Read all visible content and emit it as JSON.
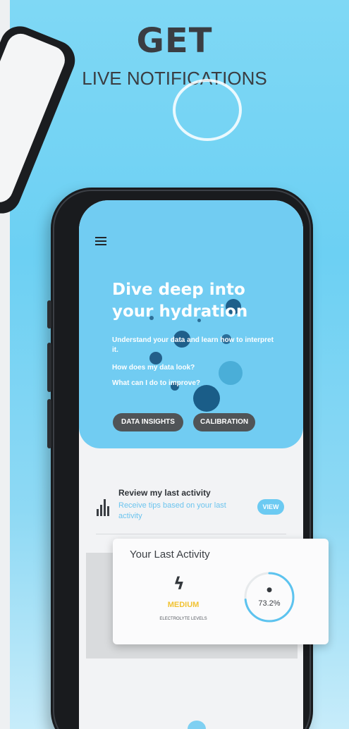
{
  "header": {
    "title": "GET",
    "subtitle": "LIVE NOTIFICATIONS"
  },
  "hero": {
    "title": "Dive deep into your hydration",
    "text1": "Understand your data and learn how to interpret it.",
    "text2": "How does my data look?",
    "text3": "What can I do to improve?",
    "buttons": {
      "insights": "DATA INSIGHTS",
      "calibration": "CALIBRATION"
    }
  },
  "activity": {
    "title": "Review my last activity",
    "subtitle": "Receive tips based on your last activity",
    "view_label": "VIEW"
  },
  "card": {
    "title": "Your Last Activity",
    "level_value": "MEDIUM",
    "level_caption": "ELECTROLYTE LEVELS",
    "percent_label": "73.2%",
    "percent_value": 73.2,
    "drop_glyph": "●"
  },
  "colors": {
    "accent": "#6ccaf2",
    "medium": "#f1c232",
    "pill": "#505457"
  },
  "icons": [
    "menu-icon",
    "bar-chart-icon",
    "bolt-icon",
    "drop-icon"
  ]
}
